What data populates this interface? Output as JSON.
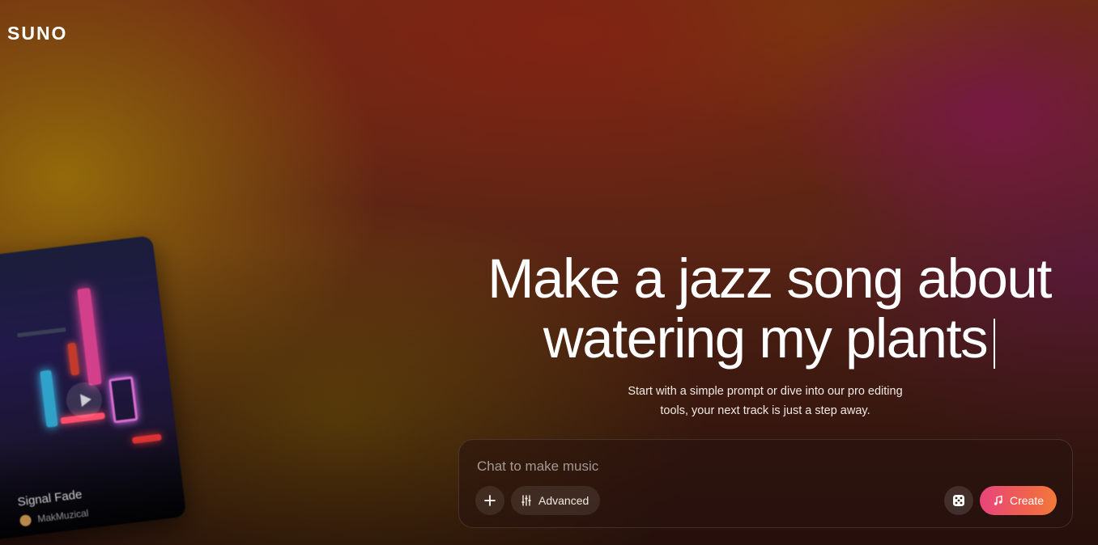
{
  "brand": {
    "logo_text": "SUNO"
  },
  "hero": {
    "headline_line1": "Make a jazz song about",
    "headline_line2": "watering my plants",
    "subtitle_line1": "Start with a simple prompt or dive into our pro editing",
    "subtitle_line2": "tools, your next track is just a step away."
  },
  "prompt_box": {
    "placeholder": "Chat to make music",
    "value": "",
    "advanced_label": "Advanced",
    "create_label": "Create",
    "icons": {
      "add": "plus-icon",
      "advanced": "sliders-icon",
      "random": "dice-icon",
      "create": "music-note-icon"
    }
  },
  "featured_song": {
    "title": "Signal Fade",
    "artist": "MakMuzical",
    "play_icon": "play-icon"
  },
  "colors": {
    "create_gradient_start": "#e8457c",
    "create_gradient_end": "#f27a3a",
    "text_primary": "#ffffff"
  }
}
